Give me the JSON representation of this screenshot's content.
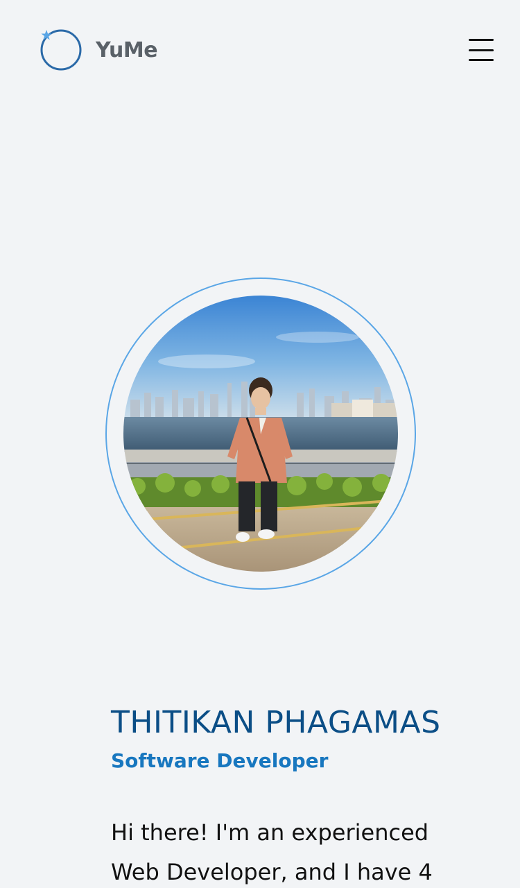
{
  "header": {
    "logo_text": "YuMe",
    "logo_icon": "circle-star-logo-icon",
    "menu_icon": "hamburger-menu-icon"
  },
  "profile": {
    "photo_icon": "profile-photo",
    "name": "THITIKAN PHAGAMAS",
    "role": "Software Developer",
    "bio": "Hi there! I'm an experienced Web Developer, and I have 4"
  },
  "colors": {
    "background": "#f2f4f6",
    "name": "#0b4e86",
    "role": "#1877bf",
    "ring": "#5aa6e6",
    "logo_text": "#5a6168"
  }
}
